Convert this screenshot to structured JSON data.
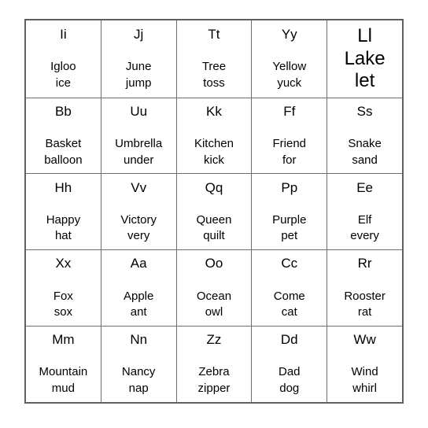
{
  "card": {
    "type": "bingo-card",
    "rows": 5,
    "columns": 5,
    "background_color": "#ffffff",
    "border_color": "#6e6e6e",
    "text_color": "#000000",
    "cells": [
      [
        {
          "letters": "Ii",
          "word1": "Igloo",
          "word2": "ice",
          "emphasis": false
        },
        {
          "letters": "Jj",
          "word1": "June",
          "word2": "jump",
          "emphasis": false
        },
        {
          "letters": "Tt",
          "word1": "Tree",
          "word2": "toss",
          "emphasis": false
        },
        {
          "letters": "Yy",
          "word1": "Yellow",
          "word2": "yuck",
          "emphasis": false
        },
        {
          "letters": "Ll",
          "word1": "Lake",
          "word2": "let",
          "emphasis": true
        }
      ],
      [
        {
          "letters": "Bb",
          "word1": "Basket",
          "word2": "balloon",
          "emphasis": false
        },
        {
          "letters": "Uu",
          "word1": "Umbrella",
          "word2": "under",
          "emphasis": false
        },
        {
          "letters": "Kk",
          "word1": "Kitchen",
          "word2": "kick",
          "emphasis": false
        },
        {
          "letters": "Ff",
          "word1": "Friend",
          "word2": "for",
          "emphasis": false
        },
        {
          "letters": "Ss",
          "word1": "Snake",
          "word2": "sand",
          "emphasis": false
        }
      ],
      [
        {
          "letters": "Hh",
          "word1": "Happy",
          "word2": "hat",
          "emphasis": false
        },
        {
          "letters": "Vv",
          "word1": "Victory",
          "word2": "very",
          "emphasis": false
        },
        {
          "letters": "Qq",
          "word1": "Queen",
          "word2": "quilt",
          "emphasis": false
        },
        {
          "letters": "Pp",
          "word1": "Purple",
          "word2": "pet",
          "emphasis": false
        },
        {
          "letters": "Ee",
          "word1": "Elf",
          "word2": "every",
          "emphasis": false
        }
      ],
      [
        {
          "letters": "Xx",
          "word1": "Fox",
          "word2": "sox",
          "emphasis": false
        },
        {
          "letters": "Aa",
          "word1": "Apple",
          "word2": "ant",
          "emphasis": false
        },
        {
          "letters": "Oo",
          "word1": "Ocean",
          "word2": "owl",
          "emphasis": false
        },
        {
          "letters": "Cc",
          "word1": "Come",
          "word2": "cat",
          "emphasis": false
        },
        {
          "letters": "Rr",
          "word1": "Rooster",
          "word2": "rat",
          "emphasis": false
        }
      ],
      [
        {
          "letters": "Mm",
          "word1": "Mountain",
          "word2": "mud",
          "emphasis": false
        },
        {
          "letters": "Nn",
          "word1": "Nancy",
          "word2": "nap",
          "emphasis": false
        },
        {
          "letters": "Zz",
          "word1": "Zebra",
          "word2": "zipper",
          "emphasis": false
        },
        {
          "letters": "Dd",
          "word1": "Dad",
          "word2": "dog",
          "emphasis": false
        },
        {
          "letters": "Ww",
          "word1": "Wind",
          "word2": "whirl",
          "emphasis": false
        }
      ]
    ]
  }
}
